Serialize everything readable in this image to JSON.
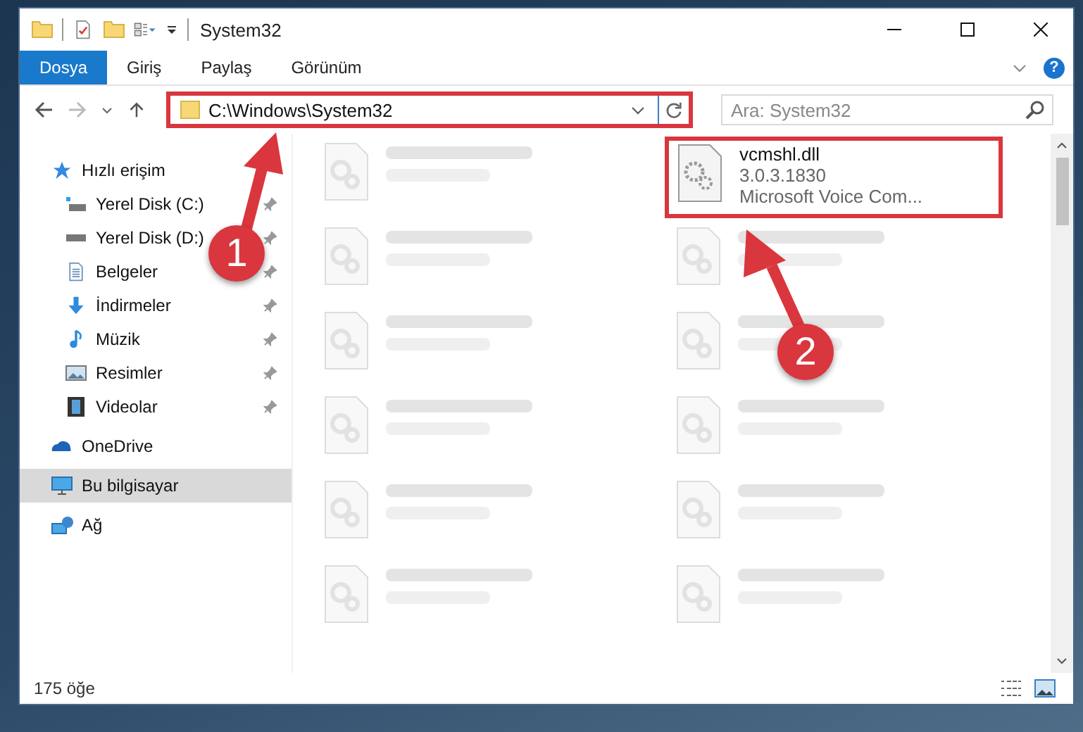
{
  "window": {
    "title": "System32"
  },
  "ribbon_tabs": [
    {
      "label": "Dosya",
      "selected": true
    },
    {
      "label": "Giriş",
      "selected": false
    },
    {
      "label": "Paylaş",
      "selected": false
    },
    {
      "label": "Görünüm",
      "selected": false
    }
  ],
  "help_button": {
    "label": "?"
  },
  "address_bar": {
    "path": "C:\\Windows\\System32",
    "highlighted": true
  },
  "search": {
    "placeholder": "Ara: System32"
  },
  "sidebar": {
    "items": [
      {
        "label": "Hızlı erişim",
        "kind": "quick",
        "selected": false,
        "children": [
          {
            "label": "Yerel Disk (C:)",
            "kind": "diskc",
            "pinned": true,
            "selected": false
          },
          {
            "label": "Yerel Disk (D:)",
            "kind": "disk",
            "pinned": true,
            "selected": false
          },
          {
            "label": "Belgeler",
            "kind": "docs",
            "pinned": true,
            "selected": false
          },
          {
            "label": "İndirmeler",
            "kind": "download",
            "pinned": true,
            "selected": false
          },
          {
            "label": "Müzik",
            "kind": "music",
            "pinned": true,
            "selected": false
          },
          {
            "label": "Resimler",
            "kind": "pictures",
            "pinned": true,
            "selected": false
          },
          {
            "label": "Videolar",
            "kind": "video",
            "pinned": true,
            "selected": false
          }
        ]
      },
      {
        "label": "OneDrive",
        "kind": "cloud",
        "selected": false
      },
      {
        "label": "Bu bilgisayar",
        "kind": "pc",
        "selected": true
      },
      {
        "label": "Ağ",
        "kind": "network",
        "selected": false
      }
    ]
  },
  "files": [
    {
      "highlighted": false
    },
    {
      "name": "vcmshl.dll",
      "line_2": "3.0.3.1830",
      "line_3": "Microsoft Voice Com...",
      "highlighted": true
    },
    {
      "highlighted": false
    },
    {
      "highlighted": false
    },
    {
      "highlighted": false
    },
    {
      "highlighted": false
    },
    {
      "highlighted": false
    },
    {
      "highlighted": false
    },
    {
      "highlighted": false
    },
    {
      "highlighted": false
    },
    {
      "highlighted": false
    },
    {
      "highlighted": false
    }
  ],
  "status_bar": {
    "item_count": "175 öğe"
  },
  "annotations": [
    {
      "number": "1"
    },
    {
      "number": "2"
    }
  ]
}
